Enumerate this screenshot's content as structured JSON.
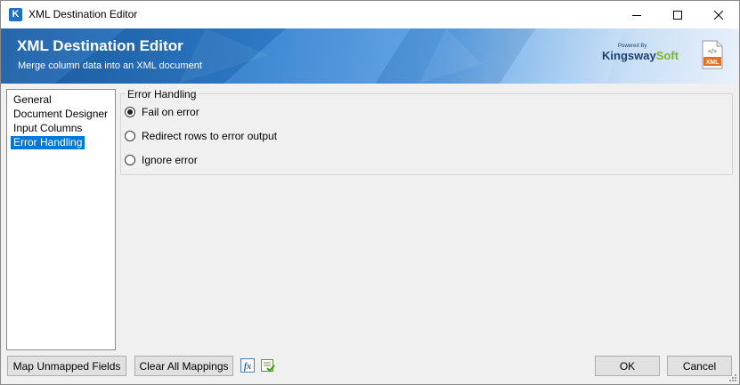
{
  "window": {
    "title": "XML Destination Editor"
  },
  "banner": {
    "title": "XML Destination Editor",
    "subtitle": "Merge column data into an XML document",
    "logo_powered": "Powered By",
    "logo_k": "K",
    "logo_ingsway": "ingsway",
    "logo_soft": "Soft",
    "xml_icon_label": "XML",
    "xml_icon_glyph": "</>"
  },
  "nav": {
    "items": [
      {
        "label": "General",
        "selected": false
      },
      {
        "label": "Document Designer",
        "selected": false
      },
      {
        "label": "Input Columns",
        "selected": false
      },
      {
        "label": "Error Handling",
        "selected": true
      }
    ]
  },
  "error_handling": {
    "legend": "Error Handling",
    "options": [
      {
        "label": "Fail on error",
        "checked": true
      },
      {
        "label": "Redirect rows to error output",
        "checked": false
      },
      {
        "label": "Ignore error",
        "checked": false
      }
    ]
  },
  "footer": {
    "map_unmapped_label": "Map Unmapped Fields",
    "clear_mappings_label": "Clear All Mappings",
    "ok_label": "OK",
    "cancel_label": "Cancel"
  },
  "colors": {
    "accent": "#0078d7",
    "banner_dark": "#1b5fa6",
    "brand_green": "#77b829"
  }
}
